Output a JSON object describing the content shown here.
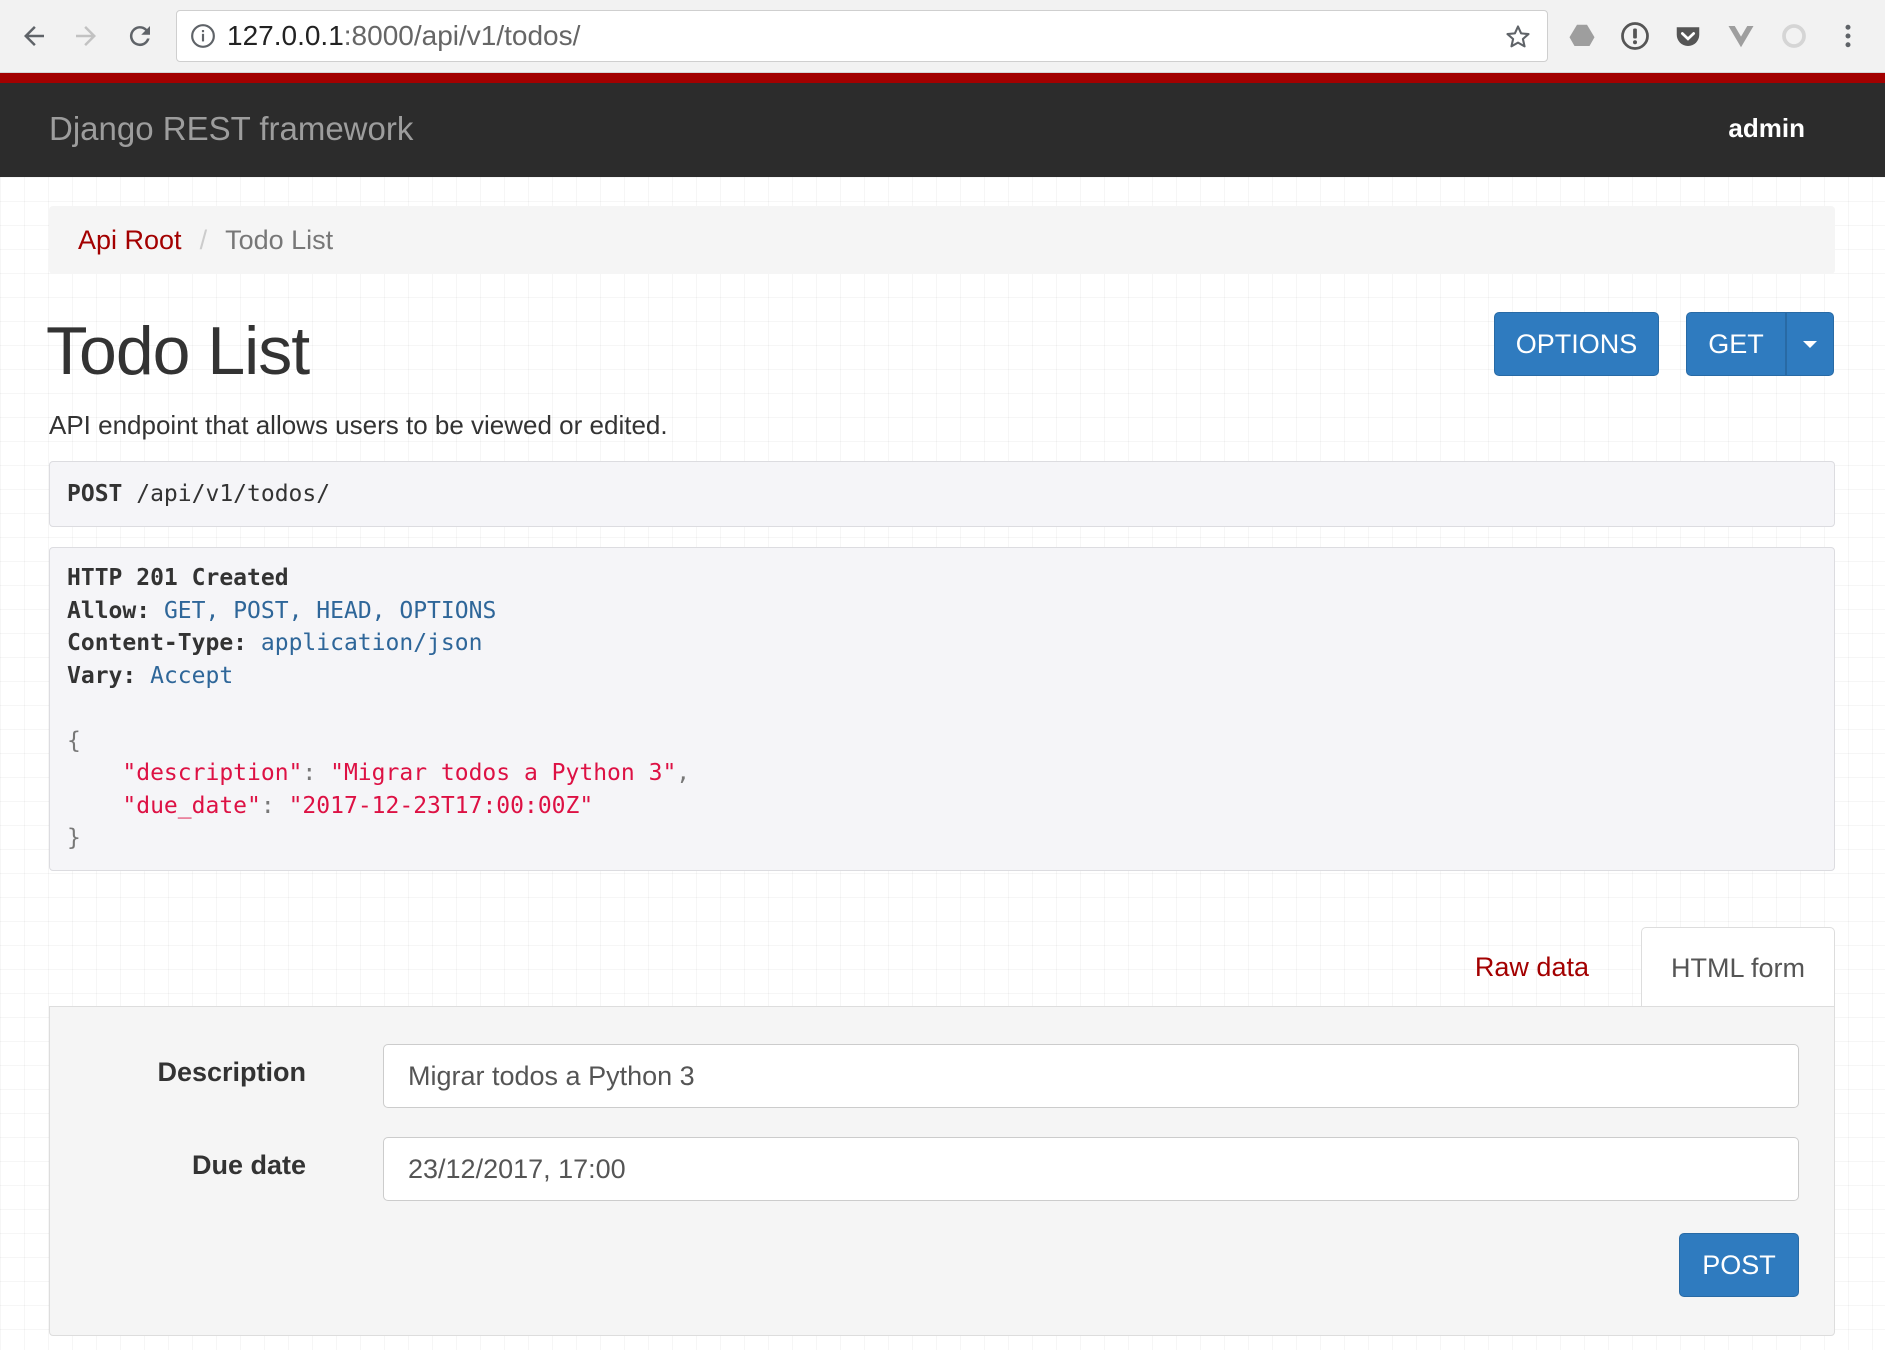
{
  "browser": {
    "url_host": "127.0.0.1",
    "url_rest": ":8000/api/v1/todos/"
  },
  "navbar": {
    "brand": "Django REST framework",
    "user": "admin",
    "accent_color": "#a30000"
  },
  "breadcrumb": {
    "root": "Api Root",
    "separator": "/",
    "current": "Todo List"
  },
  "page": {
    "title": "Todo List",
    "description": "API endpoint that allows users to be viewed or edited."
  },
  "actions": {
    "options": "OPTIONS",
    "get": "GET"
  },
  "request": {
    "method": "POST",
    "path": " /api/v1/todos/"
  },
  "response": {
    "status": "HTTP 201 Created",
    "headers": [
      {
        "name": "Allow:",
        "value": "GET, POST, HEAD, OPTIONS"
      },
      {
        "name": "Content-Type:",
        "value": "application/json"
      },
      {
        "name": "Vary:",
        "value": "Accept"
      }
    ],
    "open_brace": "{",
    "close_brace": "}",
    "body": [
      {
        "key": "\"description\"",
        "value": "\"Migrar todos a Python 3\"",
        "comma": ","
      },
      {
        "key": "\"due_date\"",
        "value": "\"2017-12-23T17:00:00Z\"",
        "comma": ""
      }
    ]
  },
  "tabs": {
    "raw": "Raw data",
    "html": "HTML form"
  },
  "form": {
    "description_label": "Description",
    "description_value": "Migrar todos a Python 3",
    "due_date_label": "Due date",
    "due_date_value": "23/12/2017, 17:00",
    "submit": "POST"
  },
  "icons": [
    "back-arrow-icon",
    "forward-arrow-icon",
    "reload-icon",
    "info-icon",
    "star-icon",
    "drive-icon",
    "password-icon",
    "pocket-icon",
    "vue-icon",
    "sync-icon",
    "kebab-menu-icon",
    "caret-down-icon"
  ]
}
